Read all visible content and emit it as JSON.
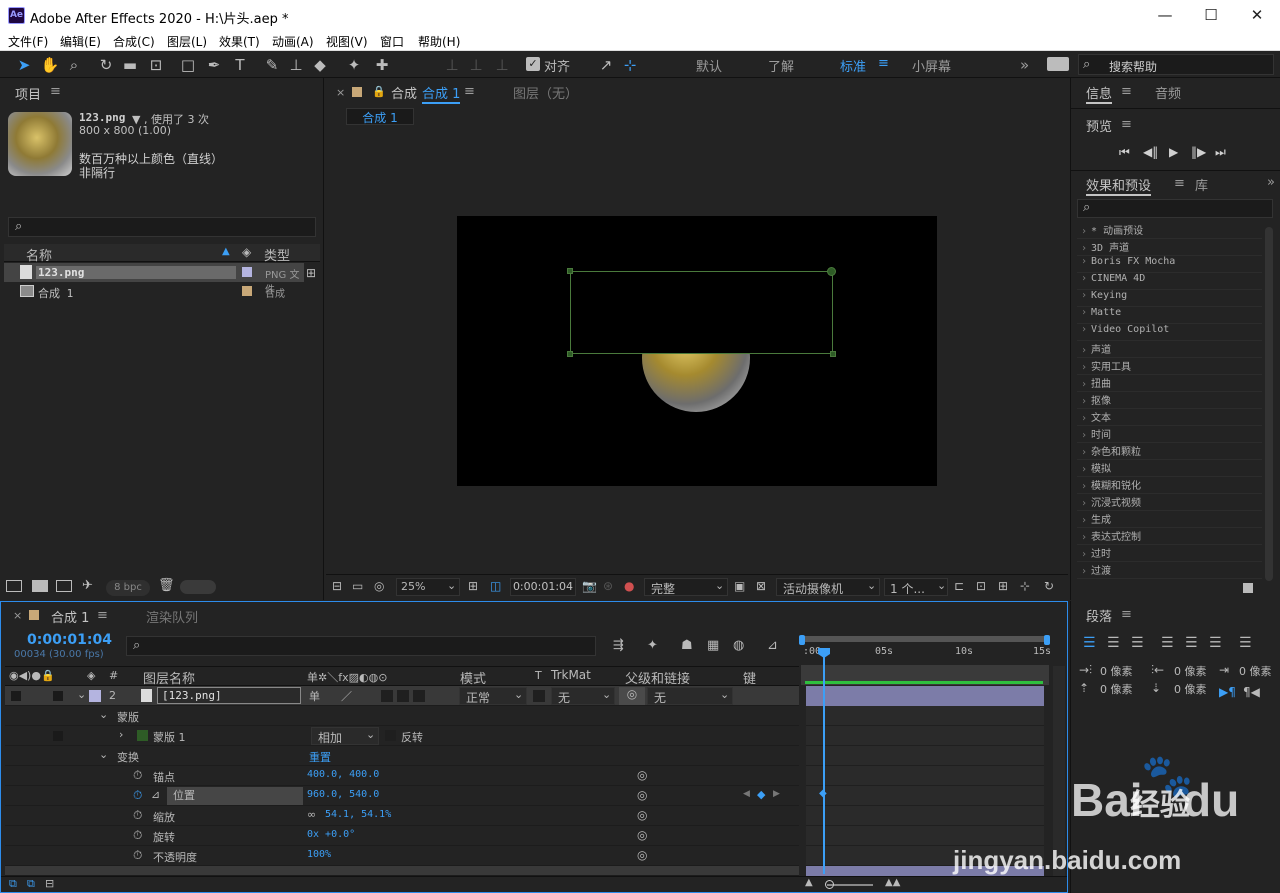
{
  "window": {
    "title": "Adobe After Effects 2020 - H:\\片头.aep *",
    "app_icon": "Ae"
  },
  "menu": [
    "文件(F)",
    "编辑(E)",
    "合成(C)",
    "图层(L)",
    "效果(T)",
    "动画(A)",
    "视图(V)",
    "窗口",
    "帮助(H)"
  ],
  "toolbar": {
    "snap_label": "对齐",
    "workspaces": [
      "默认",
      "了解",
      "标准",
      "小屏幕"
    ],
    "active_workspace": "标准",
    "search_placeholder": "搜索帮助"
  },
  "project": {
    "tab": "项目",
    "file_name": "123.png",
    "usage": "▼ , 使用了 3 次",
    "dims": "800 x 800 (1.00)",
    "color": "数百万种以上颜色（直线）",
    "interlace": "非隔行",
    "col_name": "名称",
    "col_type": "类型",
    "items": [
      {
        "name": "123.png",
        "type": "PNG 文件",
        "swatch": "#b4b4e0"
      },
      {
        "name": "合成 1",
        "type": "合成",
        "swatch": "#c8a878"
      }
    ],
    "bpc": "8 bpc"
  },
  "comp_viewer": {
    "tab_close": "×",
    "tab_prefix": "合成",
    "tab_name": "合成 1",
    "layer_tab": "图层（无）",
    "breadcrumb": "合成 1",
    "zoom": "25%",
    "timecode": "0:00:01:04",
    "quality": "完整",
    "camera": "活动摄像机",
    "views": "1 个..."
  },
  "info_panel": {
    "tabs": [
      "信息",
      "音频"
    ]
  },
  "preview": {
    "title": "预览"
  },
  "effects": {
    "tabs": [
      "效果和预设",
      "库"
    ],
    "items": [
      "* 动画预设",
      "3D 声道",
      "Boris FX Mocha",
      "CINEMA 4D",
      "Keying",
      "Matte",
      "Video Copilot",
      "声道",
      "实用工具",
      "扭曲",
      "抠像",
      "文本",
      "时间",
      "杂色和颗粒",
      "模拟",
      "模糊和锐化",
      "沉浸式视频",
      "生成",
      "表达式控制",
      "过时",
      "过渡"
    ]
  },
  "paragraph": {
    "title": "段落",
    "px_label": "0 像素"
  },
  "timeline": {
    "tab": "合成 1",
    "render_tab": "渲染队列",
    "timecode": "0:00:01:04",
    "frame_info": "00034 (30.00 fps)",
    "col_layer": "图层名称",
    "col_mode": "模式",
    "col_trkmat": "TrkMat",
    "col_parent": "父级和链接",
    "col_keys": "键",
    "col_t": "T",
    "col_hash": "#",
    "layer_num": "2",
    "layer_name": "[123.png]",
    "mode": "正常",
    "parent": "无",
    "trk": "无",
    "mask_group": "蒙版",
    "mask_name": "蒙版 1",
    "mask_mode": "相加",
    "invert": "反转",
    "transform": "变换",
    "reset": "重置",
    "props": [
      {
        "name": "锚点",
        "value": "400.0, 400.0"
      },
      {
        "name": "位置",
        "value": "960.0, 540.0"
      },
      {
        "name": "缩放",
        "value": "54.1, 54.1%"
      },
      {
        "name": "旋转",
        "value": "0x +0.0°"
      },
      {
        "name": "不透明度",
        "value": "100%"
      }
    ],
    "ruler": [
      ":00",
      "05s",
      "10s",
      "15s"
    ]
  },
  "watermark": {
    "brand": "Bai",
    "brand2": "du",
    "cn": "经验",
    "url": "jingyan.baidu.com"
  }
}
